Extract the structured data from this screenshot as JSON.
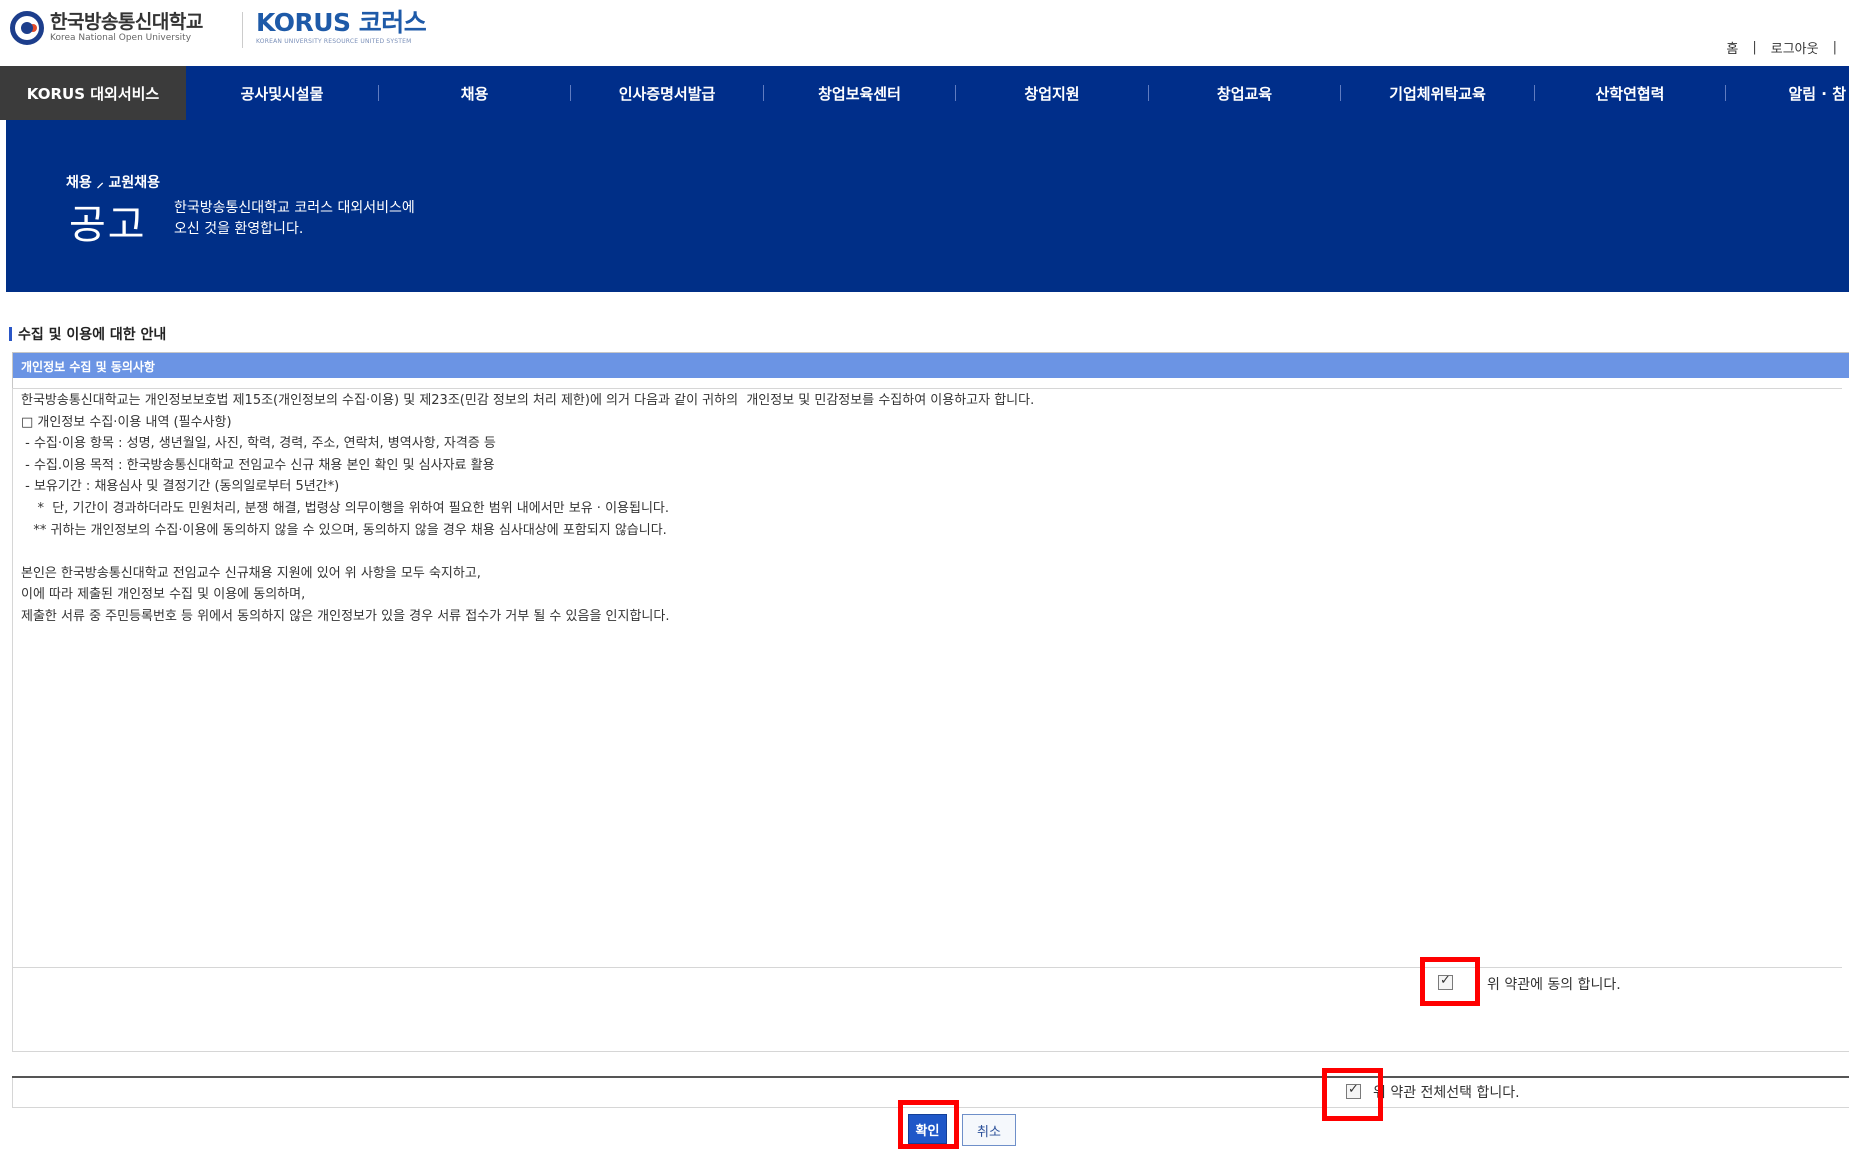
{
  "header": {
    "knou_logo_kr": "한국방송통신대학교",
    "knou_logo_en": "Korea National Open University",
    "korus_logo": "KORUS 코러스",
    "korus_sub": "KOREAN UNIVERSITY RESOURCE UNITED SYSTEM",
    "home_link": "홈",
    "logout_link": "로그아웃",
    "separator": "|"
  },
  "nav": {
    "items": [
      {
        "label": "KORUS 대외서비스"
      },
      {
        "label": "공사및시설물"
      },
      {
        "label": "채용"
      },
      {
        "label": "인사증명서발급"
      },
      {
        "label": "창업보육센터"
      },
      {
        "label": "창업지원"
      },
      {
        "label": "창업교육"
      },
      {
        "label": "기업체위탁교육"
      },
      {
        "label": "산학연협력"
      },
      {
        "label": "알림 · 참"
      }
    ]
  },
  "banner": {
    "breadcrumb": "채용 ⸝ 교원채용",
    "title": "공고",
    "welcome_line1": "한국방송통신대학교 코러스 대외서비스에",
    "welcome_line2": "오신 것을 환영합니다."
  },
  "section": {
    "title": "수집 및 이용에 대한 안내",
    "box_header": "개인정보 수집 및 동의사항"
  },
  "terms": {
    "lines": [
      "한국방송통신대학교는 개인정보보호법 제15조(개인정보의 수집·이용) 및 제23조(민감 정보의 처리 제한)에 의거 다음과 같이 귀하의  개인정보 및 민감정보를 수집하여 이용하고자 합니다.",
      "□ 개인정보 수집·이용 내역 (필수사항)",
      " - 수집·이용 항목 : 성명, 생년월일, 사진, 학력, 경력, 주소, 연락처, 병역사항, 자격증 등",
      " - 수집.이용 목적 : 한국방송통신대학교 전임교수 신규 채용 본인 확인 및 심사자료 활용",
      " - 보유기간 : 채용심사 및 결정기간 (동의일로부터 5년간*)",
      "    *  단, 기간이 경과하더라도 민원처리, 분쟁 해결, 법령상 의무이행을 위하여 필요한 범위 내에서만 보유 · 이용됩니다.",
      "   ** 귀하는 개인정보의 수집·이용에 동의하지 않을 수 있으며, 동의하지 않을 경우 채용 심사대상에 포함되지 않습니다.",
      "",
      "본인은 한국방송통신대학교 전임교수 신규채용 지원에 있어 위 사항을 모두 숙지하고,",
      "이에 따라 제출된 개인정보 수집 및 이용에 동의하며,",
      "제출한 서류 중 주민등록번호 등 위에서 동의하지 않은 개인정보가 있을 경우 서류 접수가 거부 될 수 있음을 인지합니다."
    ]
  },
  "agree": {
    "terms_agree_label": "위 약관에 동의 합니다.",
    "select_all_label": "위 약관 전체선택 합니다.",
    "terms_agree_checked": true,
    "select_all_checked": true
  },
  "buttons": {
    "confirm": "확인",
    "cancel": "취소"
  },
  "colors": {
    "nav_bg": "#002e8a",
    "banner_bg": "#002f87",
    "box_header_bg": "#6b94e4",
    "highlight": "#ff0000",
    "confirm_bg": "#1f57c8"
  }
}
